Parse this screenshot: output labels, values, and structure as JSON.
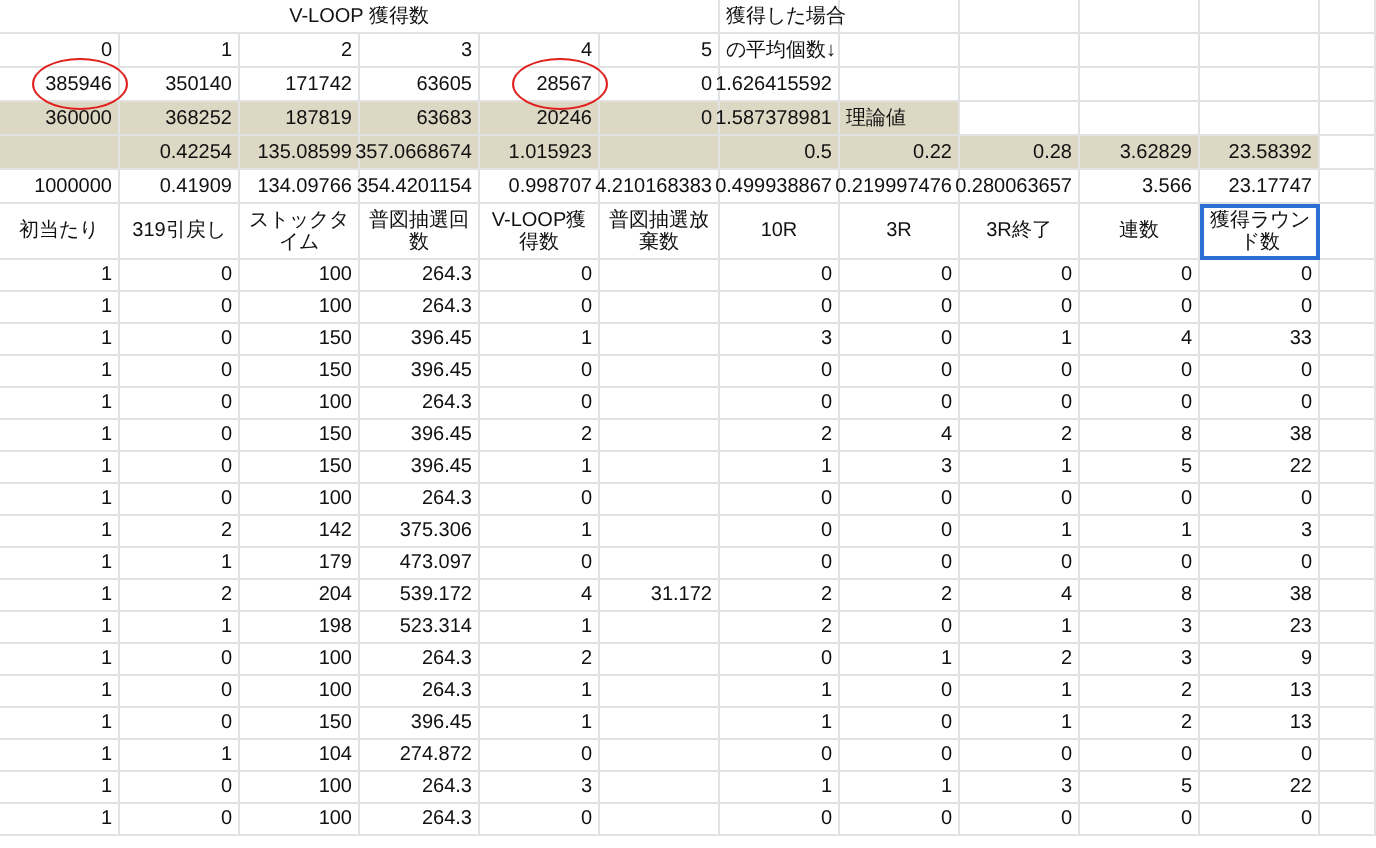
{
  "title_row": {
    "title": "V-LOOP 獲得数",
    "note": "獲得した場合"
  },
  "top_rows": [
    {
      "shaded": false,
      "cells": [
        "0",
        "1",
        "2",
        "3",
        "4",
        "5",
        {
          "text": "の平均個数↓",
          "kind": "label"
        }
      ]
    },
    {
      "shaded": false,
      "cells": [
        {
          "text": "385946",
          "circled": true
        },
        "350140",
        "171742",
        "63605",
        {
          "text": "28567",
          "circled": true
        },
        "0",
        "1.626415592"
      ]
    },
    {
      "shaded": true,
      "cells": [
        "360000",
        "368252",
        "187819",
        "63683",
        "20246",
        "0",
        "1.587378981",
        {
          "text": "理論値",
          "kind": "label"
        }
      ]
    },
    {
      "shaded": true,
      "cells": [
        null,
        "0.42254",
        "135.08599",
        "357.0668674",
        "1.015923",
        null,
        "0.5",
        "0.22",
        "0.28",
        "3.62829",
        "23.58392"
      ]
    },
    {
      "shaded": false,
      "cells": [
        "1000000",
        "0.41909",
        "134.09766",
        "354.4201154",
        "0.998707",
        "4.210168383",
        "0.499938867",
        "0.219997476",
        "0.280063657",
        "3.566",
        "23.17747"
      ]
    }
  ],
  "columns": [
    {
      "label": "初当たり",
      "selected": false
    },
    {
      "label": "319引戻し",
      "selected": false
    },
    {
      "label": "ストックタイム",
      "selected": false
    },
    {
      "label": "普図抽選回数",
      "selected": false
    },
    {
      "label": "V-LOOP獲得数",
      "selected": false
    },
    {
      "label": "普図抽選放棄数",
      "selected": false
    },
    {
      "label": "10R",
      "selected": false
    },
    {
      "label": "3R",
      "selected": false
    },
    {
      "label": "3R終了",
      "selected": false
    },
    {
      "label": "連数",
      "selected": false
    },
    {
      "label": "獲得ラウンド数",
      "selected": true
    }
  ],
  "data_rows": [
    [
      "1",
      "0",
      "100",
      "264.3",
      "0",
      null,
      "0",
      "0",
      "0",
      "0",
      "0"
    ],
    [
      "1",
      "0",
      "100",
      "264.3",
      "0",
      null,
      "0",
      "0",
      "0",
      "0",
      "0"
    ],
    [
      "1",
      "0",
      "150",
      "396.45",
      "1",
      null,
      "3",
      "0",
      "1",
      "4",
      "33"
    ],
    [
      "1",
      "0",
      "150",
      "396.45",
      "0",
      null,
      "0",
      "0",
      "0",
      "0",
      "0"
    ],
    [
      "1",
      "0",
      "100",
      "264.3",
      "0",
      null,
      "0",
      "0",
      "0",
      "0",
      "0"
    ],
    [
      "1",
      "0",
      "150",
      "396.45",
      "2",
      null,
      "2",
      "4",
      "2",
      "8",
      "38"
    ],
    [
      "1",
      "0",
      "150",
      "396.45",
      "1",
      null,
      "1",
      "3",
      "1",
      "5",
      "22"
    ],
    [
      "1",
      "0",
      "100",
      "264.3",
      "0",
      null,
      "0",
      "0",
      "0",
      "0",
      "0"
    ],
    [
      "1",
      "2",
      "142",
      "375.306",
      "1",
      null,
      "0",
      "0",
      "1",
      "1",
      "3"
    ],
    [
      "1",
      "1",
      "179",
      "473.097",
      "0",
      null,
      "0",
      "0",
      "0",
      "0",
      "0"
    ],
    [
      "1",
      "2",
      "204",
      "539.172",
      "4",
      "31.172",
      "2",
      "2",
      "4",
      "8",
      "38"
    ],
    [
      "1",
      "1",
      "198",
      "523.314",
      "1",
      null,
      "2",
      "0",
      "1",
      "3",
      "23"
    ],
    [
      "1",
      "0",
      "100",
      "264.3",
      "2",
      null,
      "0",
      "1",
      "2",
      "3",
      "9"
    ],
    [
      "1",
      "0",
      "100",
      "264.3",
      "1",
      null,
      "1",
      "0",
      "1",
      "2",
      "13"
    ],
    [
      "1",
      "0",
      "150",
      "396.45",
      "1",
      null,
      "1",
      "0",
      "1",
      "2",
      "13"
    ],
    [
      "1",
      "1",
      "104",
      "274.872",
      "0",
      null,
      "0",
      "0",
      "0",
      "0",
      "0"
    ],
    [
      "1",
      "0",
      "100",
      "264.3",
      "3",
      null,
      "1",
      "1",
      "3",
      "5",
      "22"
    ],
    [
      "1",
      "0",
      "100",
      "264.3",
      "0",
      null,
      "0",
      "0",
      "0",
      "0",
      "0"
    ]
  ]
}
